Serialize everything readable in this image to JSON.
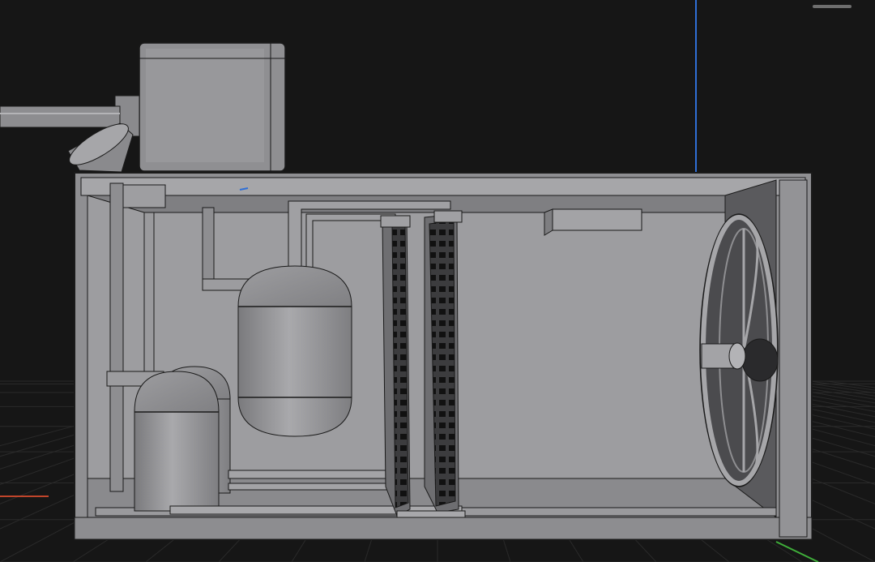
{
  "viewport": {
    "background": "#161616",
    "grid_color": "#2a2a2a",
    "axis_y_color": "#2f6fd6",
    "axis_x_color": "#c0452b",
    "axis_z_color": "#3fae3a"
  },
  "model": {
    "shade_light": "#a8a8ab",
    "shade_mid": "#8f8f92",
    "shade_dark": "#6c6c6f",
    "interior": "#9b9b9e",
    "shadow": "#3a3a3c",
    "outline": "#1a1a1a"
  },
  "icons": {
    "panel_grip": "panel-grip-icon"
  }
}
